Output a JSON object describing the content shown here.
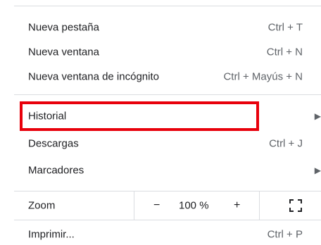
{
  "menu": {
    "items_top": [
      {
        "label": "Nueva pestaña",
        "shortcut": "Ctrl + T"
      },
      {
        "label": "Nueva ventana",
        "shortcut": "Ctrl + N"
      },
      {
        "label": "Nueva ventana de incógnito",
        "shortcut": "Ctrl + Mayús + N"
      }
    ],
    "history": {
      "label": "Historial"
    },
    "downloads": {
      "label": "Descargas",
      "shortcut": "Ctrl + J"
    },
    "bookmarks": {
      "label": "Marcadores"
    },
    "zoom": {
      "label": "Zoom",
      "minus": "−",
      "value": "100 %",
      "plus": "+"
    },
    "print": {
      "label": "Imprimir...",
      "shortcut": "Ctrl + P"
    }
  },
  "icons": {
    "submenu_arrow": "triangle-right-icon",
    "fullscreen": "fullscreen-icon"
  },
  "colors": {
    "highlight_border": "#e8000b",
    "divider": "#dadce0",
    "text": "#202124",
    "secondary_text": "#5f6368"
  }
}
